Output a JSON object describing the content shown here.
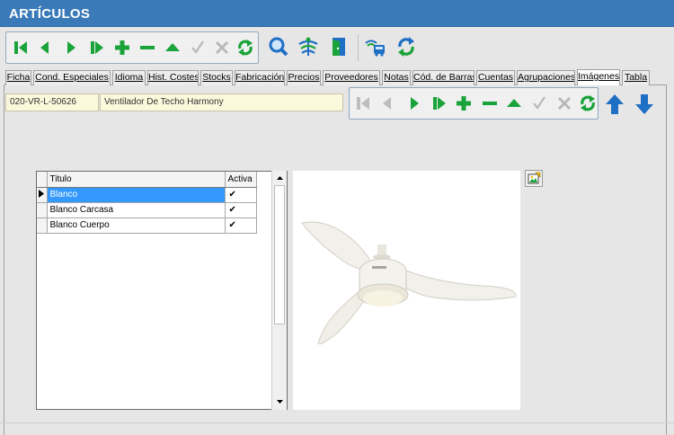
{
  "window": {
    "title": "ARTÍCULOS"
  },
  "toolbar": {
    "nav_buttons": [
      "first-icon",
      "prev-icon",
      "next-icon",
      "last-icon",
      "add-icon",
      "delete-icon",
      "edit-icon",
      "confirm-icon",
      "cancel-icon",
      "refresh-icon"
    ],
    "extra_buttons": [
      "search-icon",
      "tree-icon",
      "door-icon",
      "transport-icon",
      "sync-icon"
    ]
  },
  "tabs": [
    {
      "label": "Ficha",
      "active": false
    },
    {
      "label": "Cond. Especiales",
      "active": false
    },
    {
      "label": "Idioma",
      "active": false
    },
    {
      "label": "Hist. Costes",
      "active": false
    },
    {
      "label": "Stocks",
      "active": false
    },
    {
      "label": "Fabricación",
      "active": false
    },
    {
      "label": "Precios",
      "active": false
    },
    {
      "label": "Proveedores",
      "active": false
    },
    {
      "label": "Notas",
      "active": false
    },
    {
      "label": "Cód. de Barras",
      "active": false
    },
    {
      "label": "Cuentas",
      "active": false
    },
    {
      "label": "Agrupaciones",
      "active": false
    },
    {
      "label": "Imágenes",
      "active": true
    },
    {
      "label": "Tabla",
      "active": false
    }
  ],
  "article": {
    "code": "020-VR-L-50626",
    "description": "Ventilador De Techo Harmony"
  },
  "images_grid": {
    "columns": [
      "Titulo",
      "Activa"
    ],
    "rows": [
      {
        "titulo": "Blanco",
        "activa": "✔",
        "selected": true
      },
      {
        "titulo": "Blanco Carcasa",
        "activa": "✔",
        "selected": false
      },
      {
        "titulo": "Blanco Cuerpo",
        "activa": "✔",
        "selected": false
      }
    ]
  },
  "colors": {
    "title_bar": "#3a7ab8",
    "icon_green": "#1aa33a",
    "icon_blue": "#1f6fc4",
    "selection": "#3399ff",
    "field_bg": "#fcf8dc"
  }
}
